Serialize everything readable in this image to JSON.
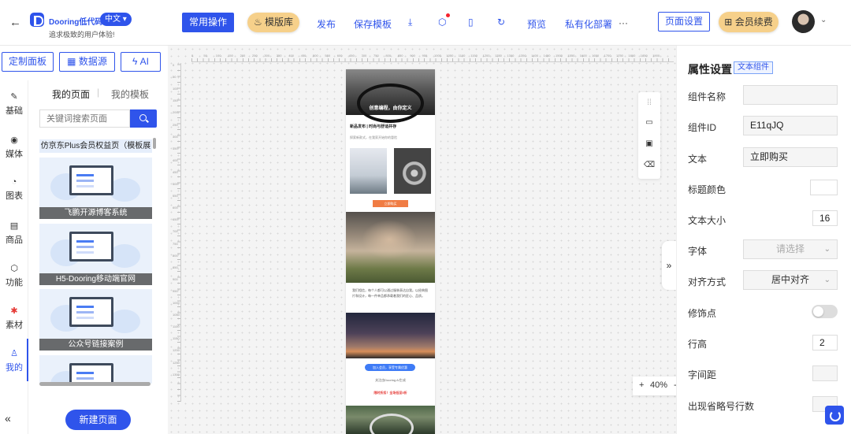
{
  "header": {
    "brand": "Dooring低代码",
    "language": "中文 ▾",
    "slogan": "追求极致的用户体验!",
    "common_ops": "常用操作",
    "template_lib": "模版库",
    "publish": "发布",
    "save_template": "保存模板",
    "preview": "预览",
    "private_deploy": "私有化部署",
    "more": "···",
    "page_settings": "页面设置",
    "membership": "会员续费"
  },
  "toolbar": {
    "custom_panel": "定制面板",
    "data_source": "数据源",
    "ai": "AI"
  },
  "leftnav": {
    "items": [
      {
        "label": "基础",
        "icon": "pen-icon"
      },
      {
        "label": "媒体",
        "icon": "media-icon"
      },
      {
        "label": "图表",
        "icon": "pie-chart-icon"
      },
      {
        "label": "商品",
        "icon": "product-icon"
      },
      {
        "label": "功能",
        "icon": "cube-icon"
      },
      {
        "label": "素材",
        "icon": "material-icon"
      },
      {
        "label": "我的",
        "icon": "user-icon"
      }
    ],
    "active": "我的"
  },
  "pages_panel": {
    "tab_mine": "我的页面",
    "tab_templates": "我的模板",
    "search_placeholder": "关键词搜索页面",
    "cards": [
      {
        "label": "仿京东Plus会员权益页（模板展示）"
      },
      {
        "label": "飞鹏开源博客系统"
      },
      {
        "label": "H5-Dooring移动端官网"
      },
      {
        "label": "公众号链接案例"
      }
    ],
    "new_page": "新建页面"
  },
  "ruler": {
    "h_ticks": [
      "0",
      "50",
      "100",
      "150",
      "200",
      "250",
      "300",
      "350",
      "400",
      "450",
      "500",
      "550",
      "600",
      "650",
      "700",
      "750",
      "800",
      "850",
      "900",
      "950",
      "1000",
      "1050",
      "1100",
      "1150",
      "1200",
      "1250",
      "1300",
      "1350",
      "1400",
      "1450",
      "1500",
      "1550",
      "1600",
      "1650",
      "1700",
      "1750",
      "1800",
      "1850",
      "1900"
    ],
    "v_ticks": [
      "0",
      "50",
      "100",
      "150",
      "200",
      "250",
      "300",
      "350",
      "400",
      "450",
      "500",
      "550",
      "600",
      "650",
      "700",
      "750",
      "800",
      "850",
      "900",
      "950",
      "1000",
      "1050",
      "1100",
      "1150",
      "1200",
      "1250",
      "1300"
    ]
  },
  "phone": {
    "banner_caption": "创意编程，由你定义",
    "title": "新品发布 | 时尚与舒适并存",
    "subtitle": "探索新款式，在我家开始你的冒险",
    "buy": "立即购买",
    "paragraph": "我们相信，每个人都可以通过服装表达自我。以经典图片和设计，每一件单品都承载着我们的匠心、品质。",
    "join": "加入会员，享受专属优惠",
    "line1": "关注由Dooring AI生成",
    "line2": "限时折扣！全场低至5折"
  },
  "canvas": {
    "zoom": "40%",
    "zoom_plus": "+",
    "zoom_minus": "-"
  },
  "props": {
    "title": "属性设置",
    "component_tag": "文本组件",
    "fields": {
      "name_label": "组件名称",
      "name_value": "",
      "id_label": "组件ID",
      "id_value": "E11qJQ",
      "text_label": "文本",
      "text_value": "立即购买",
      "title_color_label": "标题颜色",
      "font_size_label": "文本大小",
      "font_size_value": "16",
      "font_label": "字体",
      "font_placeholder": "请选择",
      "align_label": "对齐方式",
      "align_value": "居中对齐",
      "decor_label": "修饰点",
      "line_height_label": "行高",
      "line_height_value": "2",
      "letter_spacing_label": "字间距",
      "ellipsis_label": "出现省略号行数"
    }
  }
}
